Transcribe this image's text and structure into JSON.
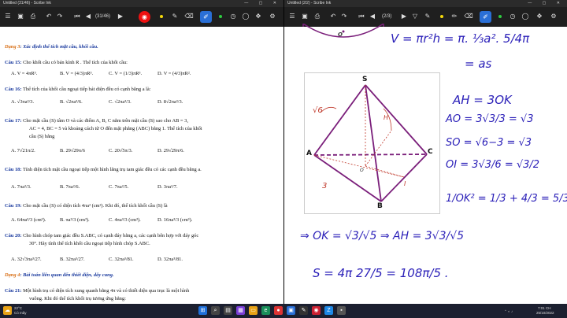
{
  "left_window": {
    "title": "Untitled (31/46) - Scribe Ink",
    "page_indicator": "(31/46)",
    "section3": {
      "tag": "Dạng 3",
      "text": ": Xác định thể tích mặt cầu, khối cầu."
    },
    "questions": [
      {
        "num": "Câu 15:",
        "text": "Cho khối cầu có bán kính R . Thể tích của khối cầu:",
        "choices": [
          "A. V = 4πR³.",
          "B. V = (4/3)πR³.",
          "C. V = (1/3)πR³.",
          "D. V = (4/3)πR².",
          ""
        ]
      },
      {
        "num": "Câu 16:",
        "text": "Thể tích của khối cầu ngoại tiếp bát diện đều có cạnh bằng a là:",
        "choices": [
          "A. √3πa³/3.",
          "B. √2πa³/6.",
          "C. √2πa³/3.",
          "D. 8√2πa³/3.",
          ""
        ]
      },
      {
        "num": "Câu 17:",
        "text": "Cho mặt cầu (S) tâm O và các điểm A, B, C nằm trên mặt cầu (S) sao cho AB = 3,",
        "text2": "AC = 4, BC = 5 và khoảng cách từ O đến mặt phẳng (ABC) bằng 1. Thể tích của khối",
        "text3": "cầu (S) bằng",
        "choices": [
          "A. 7√21π/2.",
          "B. 29√29π/6",
          "C. 20√5π/3.",
          "D. 29√29π/6.",
          ""
        ]
      },
      {
        "num": "Câu 18:",
        "text": "Tính diện tích mặt cầu ngoại tiếp một hình lăng trụ tam giác đều có các cạnh đều bằng a.",
        "choices": [
          "A. 7πa²/3.",
          "B. 7πa²/6.",
          "C. 7πa²/5.",
          "D. 3πa²/7.",
          ""
        ]
      },
      {
        "num": "Câu 19:",
        "text": "Cho mặt cầu (S) có diện tích 4πa² (cm²). Khi đó, thể tích khối cầu (S) là",
        "choices": [
          "A. 64πa³/3 (cm³).",
          "B. πa³/3 (cm³).",
          "C. 4πa³/3 (cm³).",
          "D. 16πa³/3 (cm³).",
          ""
        ]
      },
      {
        "num": "Câu 20:",
        "text": "Cho hình chóp tam giác đều S.ABC, có cạnh đáy bằng a, các cạnh bên hợp với đáy góc",
        "text2": "30°. Hãy tính thể tích khối cầu ngoại tiếp hình chóp S.ABC.",
        "choices": [
          "A. 32√3πa³/27.",
          "B. 32πa³/27.",
          "C. 32πa³/81.",
          "D. 32πa³/81.",
          ""
        ]
      }
    ],
    "section4": {
      "tag": "Dạng 4",
      "text": ": Bài toán liên quan đến thiết diện, dây cung."
    },
    "q21": {
      "num": "Câu 21:",
      "text": "Một hình trụ có diện tích xung quanh bằng 4π và có thiết diện qua trục là một hình",
      "text2": "vuông. Khi đó thể tích khối trụ tương ứng bằng:"
    }
  },
  "right_window": {
    "title": "Untitled (2/2) - Scribe Ink",
    "page_indicator": "(2/3)",
    "figure_labels": {
      "S": "S",
      "A": "A",
      "B": "B",
      "C": "C",
      "H": "H",
      "I": "I",
      "O": "O",
      "sqrt6": "√6",
      "three": "3",
      "top_o": "O"
    },
    "handwriting": {
      "v_formula": "V = πr²h = π. ⅓a². 5/4π",
      "as": "= as",
      "ah": "AH = 3OK",
      "ao": "AO = 3√3/3 = √3",
      "so": "SO = √6−3 = √3",
      "oi": "OI = 3√3/6 = √3/2",
      "sum": "1/OK² = 1/3 + 4/3 = 5/3",
      "ok": "⇒ OK = √3/√5 ⇒ AH = 3√3/√5",
      "s": "S = 4π 27/5 = 108π/5 ."
    }
  },
  "taskbar": {
    "weather_temp": "22°C",
    "weather_desc": "Có mây",
    "time": "7:01 CH",
    "date": "25/10/2022"
  },
  "colors": {
    "ink": "#2a1fb8",
    "figure": "#7a1e7a",
    "dashed": "#c0392b",
    "accent_red": "#e11",
    "accent_blue": "#2a6fd6"
  }
}
